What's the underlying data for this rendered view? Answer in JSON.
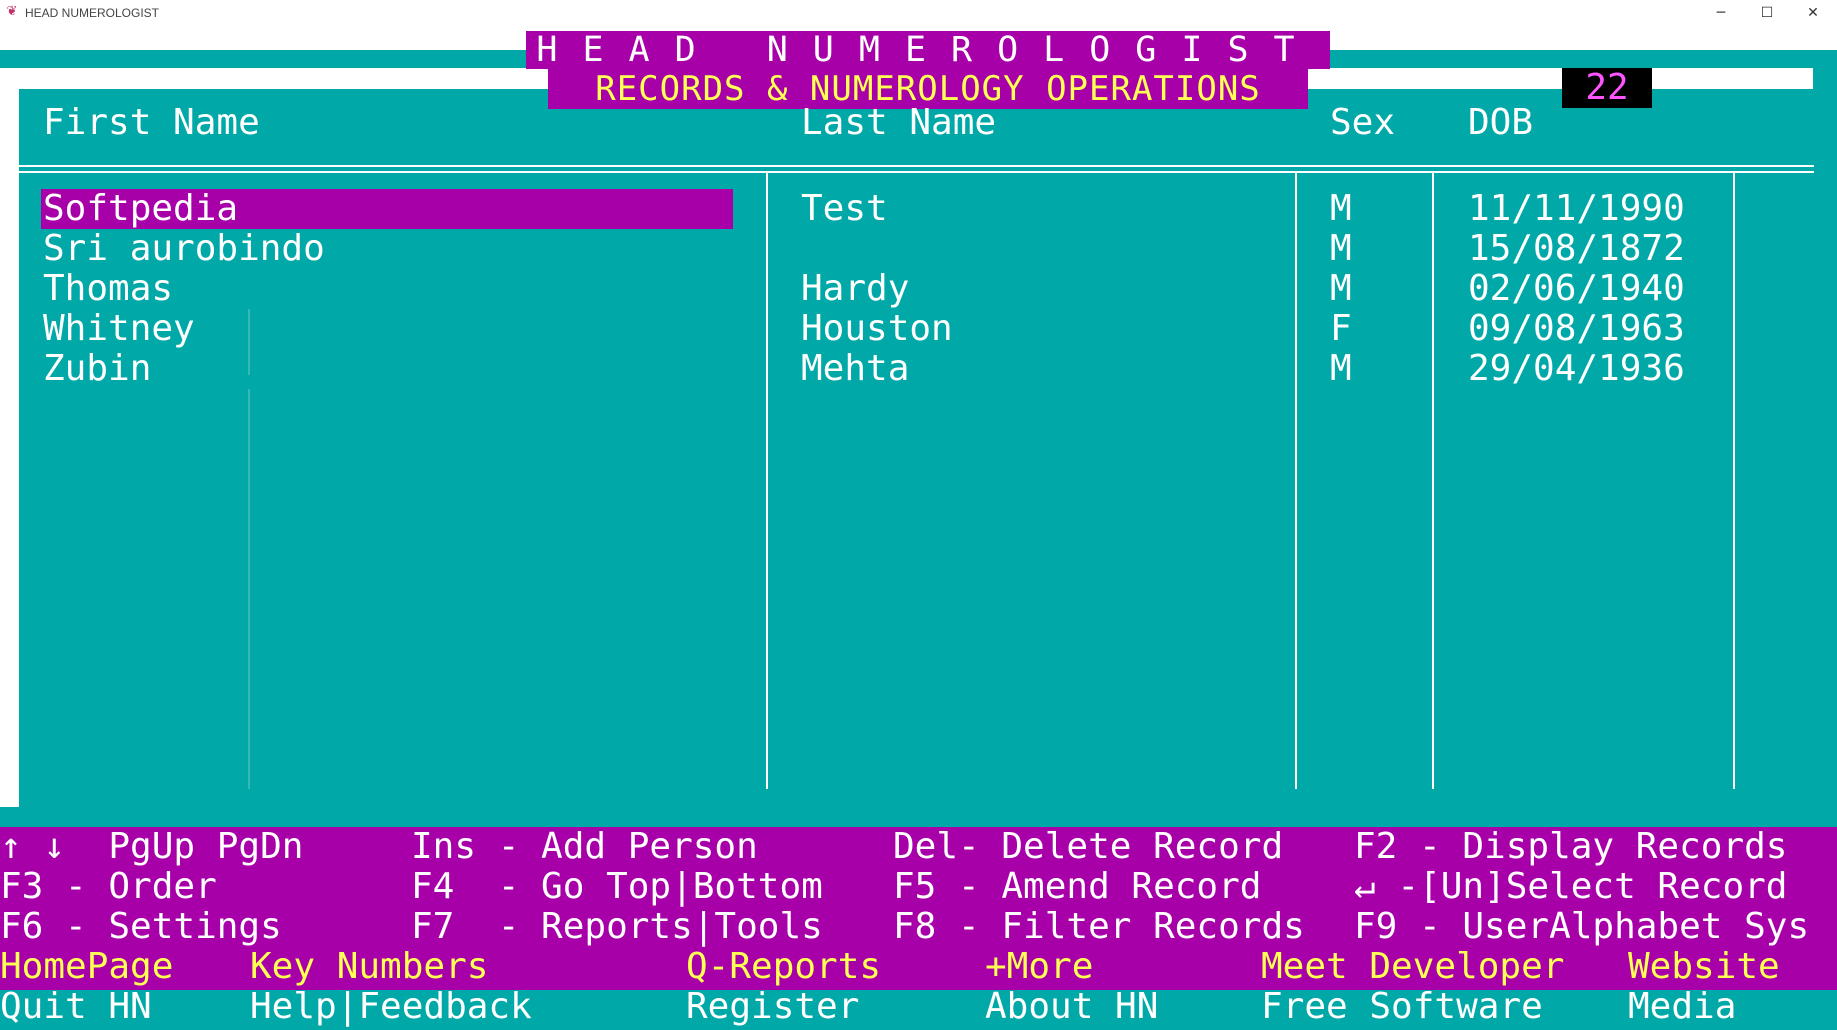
{
  "window": {
    "title": "HEAD NUMEROLOGIST",
    "minimize": "─",
    "maximize": "☐",
    "close": "✕"
  },
  "header": {
    "title": "HEAD NUMEROLOGIST",
    "subtitle": "RECORDS & NUMEROLOGY OPERATIONS",
    "counter": "22"
  },
  "table": {
    "columns": [
      "First Name",
      "Last Name",
      "Sex",
      "DOB"
    ],
    "rows": [
      {
        "first": "Softpedia",
        "last": "Test",
        "sex": "M",
        "dob": "11/11/1990"
      },
      {
        "first": "Sri aurobindo",
        "last": "",
        "sex": "M",
        "dob": "15/08/1872"
      },
      {
        "first": "Thomas",
        "last": "Hardy",
        "sex": "M",
        "dob": "02/06/1940"
      },
      {
        "first": "Whitney",
        "last": "Houston",
        "sex": "F",
        "dob": "09/08/1963"
      },
      {
        "first": "Zubin",
        "last": "Mehta",
        "sex": "M",
        "dob": "29/04/1936"
      }
    ],
    "selected_row": 0
  },
  "keys": {
    "row1": [
      "↑ ↓  PgUp PgDn",
      "Ins - Add Person",
      "Del- Delete Record",
      "F2 - Display Records"
    ],
    "row2": [
      "F3 - Order",
      "F4  - Go Top|Bottom",
      "F5 - Amend Record",
      "↵ -[Un]Select Record"
    ],
    "row3": [
      "F6 - Settings",
      "F7  - Reports|Tools",
      "F8 - Filter Records",
      "F9 - UserAlphabet Sys"
    ]
  },
  "links": {
    "row1": [
      "HomePage",
      "Key Numbers",
      "Q-Reports",
      "+More",
      "Meet Developer",
      "Website"
    ],
    "row2": [
      "Quit HN",
      "Help|Feedback",
      "Register",
      "About HN",
      "Free Software",
      "Media"
    ]
  },
  "colors": {
    "teal": "#00a8a8",
    "magenta": "#a800a8",
    "yellow": "#ffff54",
    "pink": "#ff54ff"
  }
}
